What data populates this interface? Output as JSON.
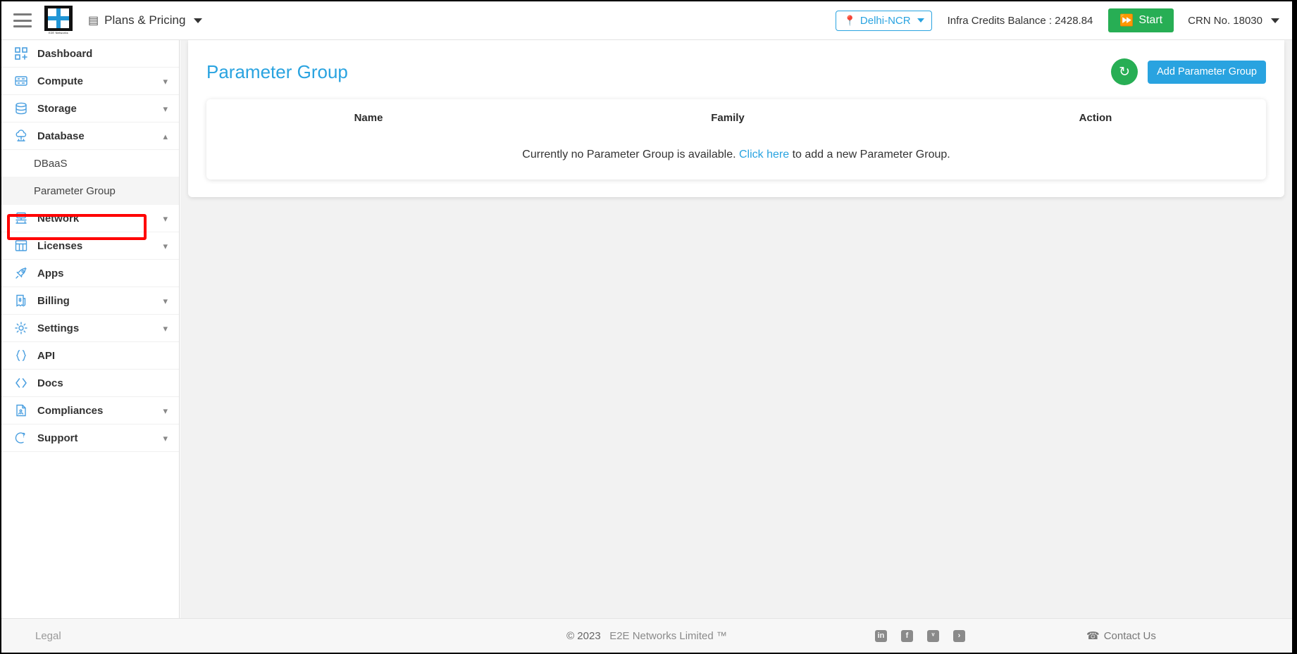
{
  "topbar": {
    "menu_icon": "hamburger-icon",
    "logo_text": "E2E Networks",
    "plans_label": "Plans & Pricing",
    "plans_icon": "list-icon",
    "region": "Delhi-NCR",
    "region_icon": "location-pin-icon",
    "credits_label": "Infra Credits Balance : 2428.84",
    "start_label": "Start",
    "start_icon": "paper-plane-icon",
    "crn_label": "CRN No. 18030"
  },
  "sidebar": {
    "items": [
      {
        "label": "Dashboard",
        "icon": "dashboard-grid-icon",
        "expandable": false
      },
      {
        "label": "Compute",
        "icon": "server-icon",
        "expandable": true,
        "chevron": "down"
      },
      {
        "label": "Storage",
        "icon": "database-disk-icon",
        "expandable": true,
        "chevron": "down"
      },
      {
        "label": "Database",
        "icon": "cloud-database-icon",
        "expandable": true,
        "chevron": "up"
      },
      {
        "label": "Network",
        "icon": "network-icon",
        "expandable": true,
        "chevron": "down"
      },
      {
        "label": "Licenses",
        "icon": "license-grid-icon",
        "expandable": true,
        "chevron": "down"
      },
      {
        "label": "Apps",
        "icon": "rocket-icon",
        "expandable": false
      },
      {
        "label": "Billing",
        "icon": "invoice-dollar-icon",
        "expandable": true,
        "chevron": "down"
      },
      {
        "label": "Settings",
        "icon": "gear-icon",
        "expandable": true,
        "chevron": "down"
      },
      {
        "label": "API",
        "icon": "braces-icon",
        "expandable": false
      },
      {
        "label": "Docs",
        "icon": "code-brackets-icon",
        "expandable": false
      },
      {
        "label": "Compliances",
        "icon": "document-icon",
        "expandable": true,
        "chevron": "down"
      },
      {
        "label": "Support",
        "icon": "support-question-icon",
        "expandable": true,
        "chevron": "down"
      }
    ],
    "database_subitems": [
      {
        "label": "DBaaS",
        "active": false
      },
      {
        "label": "Parameter Group",
        "active": true
      }
    ]
  },
  "main": {
    "page_title": "Parameter Group",
    "refresh_icon": "refresh-icon",
    "add_button_label": "Add Parameter Group",
    "table": {
      "columns": [
        "Name",
        "Family",
        "Action"
      ],
      "rows": [],
      "empty_message_prefix": "Currently no Parameter Group is available.",
      "empty_message_link": "Click here",
      "empty_message_suffix": "to add a new Parameter Group."
    }
  },
  "footer": {
    "legal_label": "Legal",
    "copyright_symbol": "© 2023",
    "copyright_brand": "E2E Networks Limited ™",
    "socials": [
      {
        "name": "linkedin-icon",
        "glyph": "in"
      },
      {
        "name": "facebook-icon",
        "glyph": "f"
      },
      {
        "name": "twitter-icon",
        "glyph": "ᵛ"
      },
      {
        "name": "rss-icon",
        "glyph": "›"
      }
    ],
    "contact_label": "Contact Us",
    "contact_icon": "phone-icon"
  },
  "colors": {
    "accent_blue": "#29a3e0",
    "accent_green": "#27ae54",
    "highlight_red": "#ff0000",
    "sidebar_icon_blue": "#4a9fe0",
    "page_bg": "#f2f2f2"
  }
}
